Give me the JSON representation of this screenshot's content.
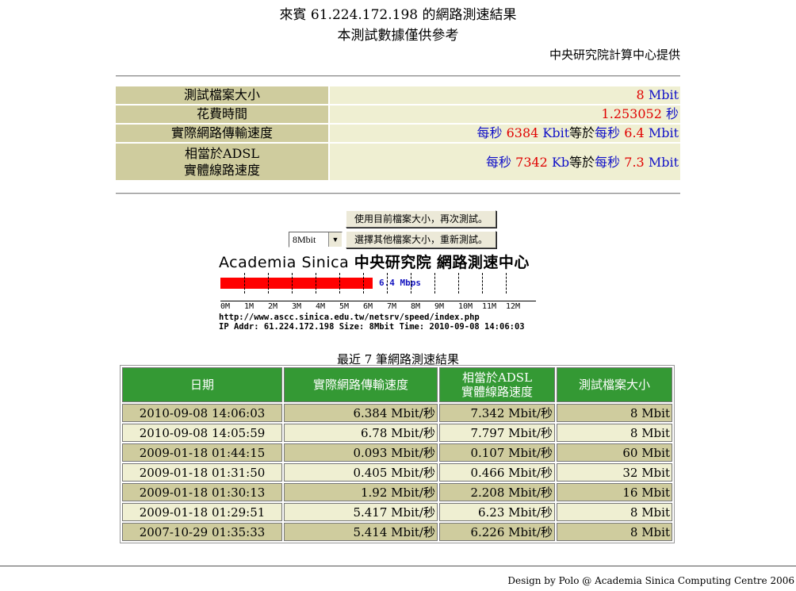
{
  "header": {
    "title": "來賓 61.224.172.198 的網路測速結果",
    "subtitle": "本測試數據僅供參考",
    "provider": "中央研究院計算中心提供"
  },
  "result": {
    "file_size_label": "測試檔案大小",
    "file_size_value": "8",
    "file_size_unit": "Mbit",
    "time_label": "花費時間",
    "time_value": "1.253052",
    "time_unit": "秒",
    "speed_label": "實際網路傳輸速度",
    "speed_prefix": "每秒",
    "speed_value_k": "6384",
    "speed_unit_k": "Kbit",
    "speed_equals": "等於",
    "speed_prefix2": "每秒",
    "speed_value_m": "6.4",
    "speed_unit_m": "Mbit",
    "adsl_label_1": "相當於ADSL",
    "adsl_label_2": "實體線路速度",
    "adsl_prefix": "每秒",
    "adsl_value_k": "7342",
    "adsl_unit_k": "Kb",
    "adsl_equals": "等於",
    "adsl_prefix2": "每秒",
    "adsl_value_m": "7.3",
    "adsl_unit_m": "Mbit"
  },
  "controls": {
    "retest_button": "使用目前檔案大小，再次測試。",
    "select_value": "8Mbit",
    "change_size_button": "選擇其他檔案大小，重新測試。"
  },
  "banner": {
    "brand_en": "Academia Sinica",
    "brand_zh": "中央研究院",
    "brand_center": "網路測速中心",
    "speed_label": "6.4 Mbps",
    "speed_fraction_of_scale": 0.533,
    "ticks": [
      "0M",
      "1M",
      "2M",
      "3M",
      "4M",
      "5M",
      "6M",
      "7M",
      "8M",
      "9M",
      "10M",
      "11M",
      "12M"
    ],
    "url": "http://www.ascc.sinica.edu.tw/netsrv/speed/index.php",
    "info": "IP Addr: 61.224.172.198 Size: 8Mbit Time: 2010-09-08 14:06:03",
    "bar_color": "#ff0000"
  },
  "history": {
    "title": "最近 7 筆網路測速結果",
    "headers": [
      "日期",
      "實際網路傳輸速度",
      "相當於ADSL",
      "實體線路速度",
      "測試檔案大小"
    ],
    "rows": [
      {
        "date": "2010-09-08 14:06:03",
        "speed": "6.384 Mbit/秒",
        "adsl": "7.342 Mbit/秒",
        "size": "8 Mbit"
      },
      {
        "date": "2010-09-08 14:05:59",
        "speed": "6.78 Mbit/秒",
        "adsl": "7.797 Mbit/秒",
        "size": "8 Mbit"
      },
      {
        "date": "2009-01-18 01:44:15",
        "speed": "0.093 Mbit/秒",
        "adsl": "0.107 Mbit/秒",
        "size": "60 Mbit"
      },
      {
        "date": "2009-01-18 01:31:50",
        "speed": "0.405 Mbit/秒",
        "adsl": "0.466 Mbit/秒",
        "size": "32 Mbit"
      },
      {
        "date": "2009-01-18 01:30:13",
        "speed": "1.92 Mbit/秒",
        "adsl": "2.208 Mbit/秒",
        "size": "16 Mbit"
      },
      {
        "date": "2009-01-18 01:29:51",
        "speed": "5.417 Mbit/秒",
        "adsl": "6.23 Mbit/秒",
        "size": "8 Mbit"
      },
      {
        "date": "2007-10-29 01:35:33",
        "speed": "5.414 Mbit/秒",
        "adsl": "6.226 Mbit/秒",
        "size": "8 Mbit"
      }
    ],
    "header_color": "#349934",
    "row_color": "#cfcc9e",
    "alt_row_color": "#efefd2"
  },
  "footer": {
    "credit": "Design by Polo @ Academia Sinica Computing Centre 2006"
  }
}
